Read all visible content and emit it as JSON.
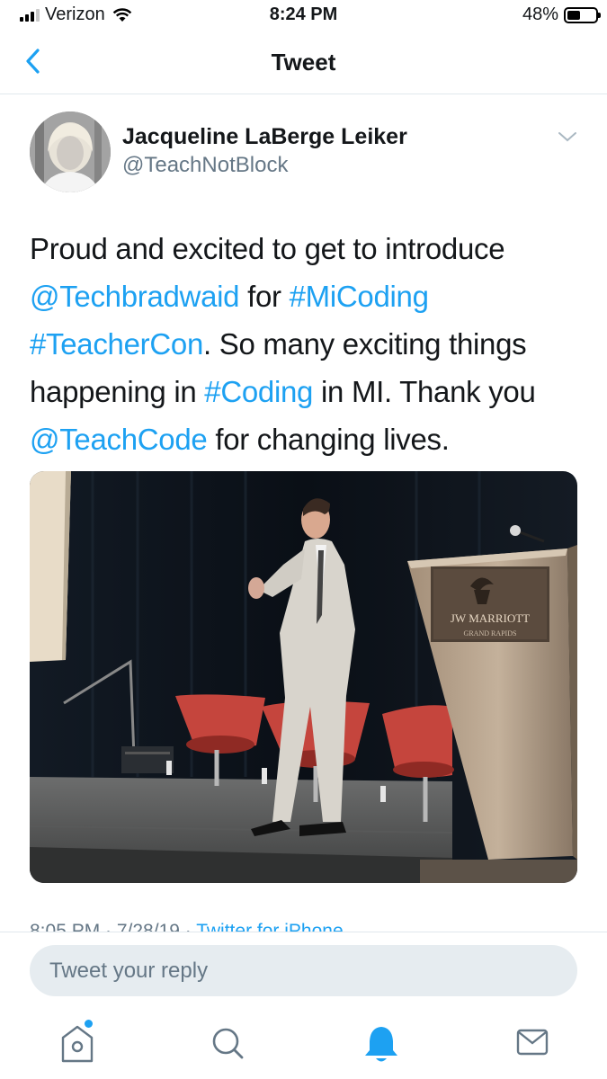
{
  "status_bar": {
    "carrier": "Verizon",
    "time": "8:24 PM",
    "battery_percent": "48%",
    "battery_level": 0.48,
    "signal_bars": 3
  },
  "nav": {
    "title": "Tweet",
    "back_icon": "chevron-left-icon"
  },
  "tweet": {
    "author_name": "Jacqueline LaBerge Leiker",
    "author_handle": "@TeachNotBlock",
    "text_runs": [
      {
        "t": "Proud and excited to get to introduce ",
        "link": false
      },
      {
        "t": "@Techbradwaid",
        "link": true
      },
      {
        "t": " for ",
        "link": false
      },
      {
        "t": "#MiCoding",
        "link": true
      },
      {
        "t": " ",
        "link": false
      },
      {
        "t": "#TeacherCon",
        "link": true
      },
      {
        "t": ". So many exciting things happening in ",
        "link": false
      },
      {
        "t": "#Coding",
        "link": true
      },
      {
        "t": " in MI. Thank you ",
        "link": false
      },
      {
        "t": "@TeachCode",
        "link": true
      },
      {
        "t": " for changing lives.",
        "link": false
      }
    ],
    "photo": {
      "podium_brand": "JW MARRIOTT",
      "podium_subtitle": "GRAND RAPIDS"
    },
    "meta_time": "8:05 PM · 7/28/19 · ",
    "meta_app": "Twitter for iPhone"
  },
  "reply": {
    "placeholder": "Tweet your reply"
  },
  "tabs": [
    {
      "name": "home",
      "icon": "home-icon"
    },
    {
      "name": "search",
      "icon": "search-icon"
    },
    {
      "name": "notifications",
      "icon": "bell-icon"
    },
    {
      "name": "messages",
      "icon": "mail-icon"
    }
  ],
  "colors": {
    "accent": "#1da1f2",
    "secondary_text": "#657786",
    "divider": "#e1e8ed",
    "reply_bg": "#e6ecf0"
  }
}
